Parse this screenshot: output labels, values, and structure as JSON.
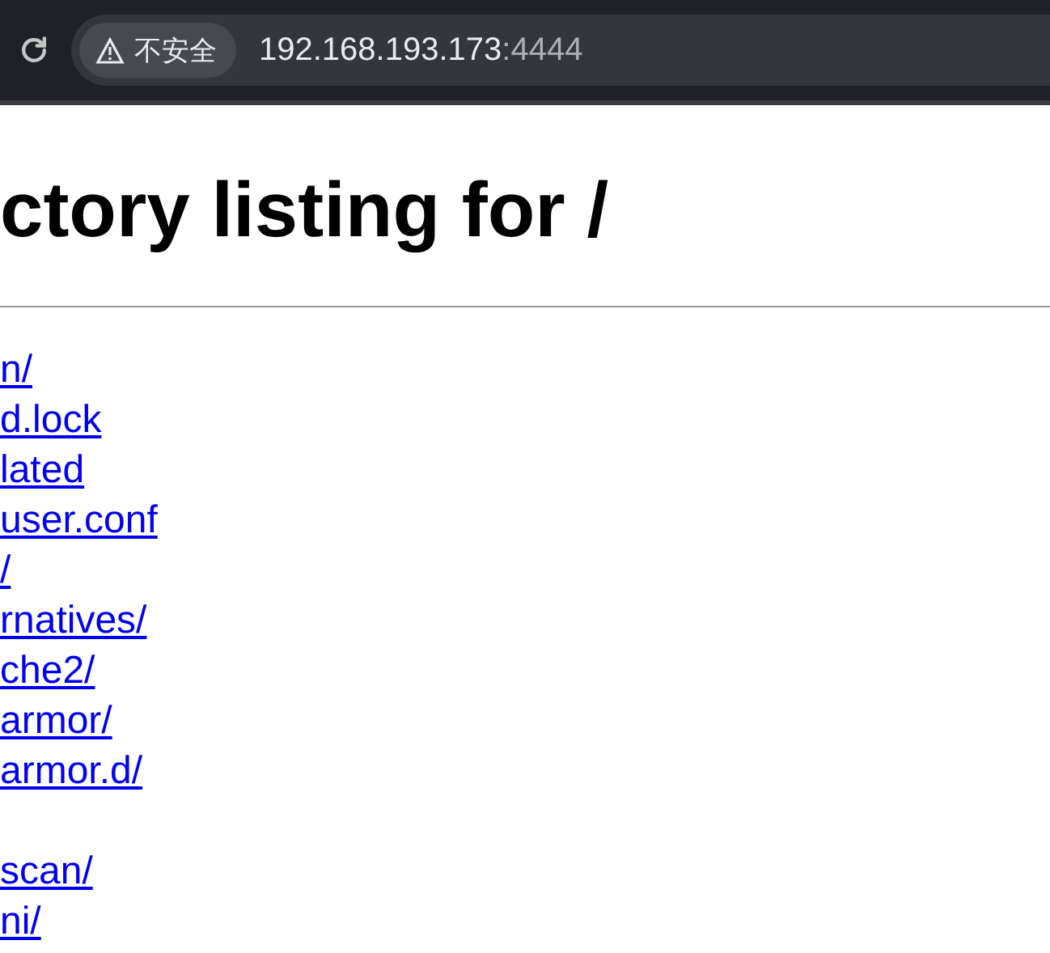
{
  "browser": {
    "security_label": "不安全",
    "url_host": "192.168.193.173",
    "url_port": ":4444"
  },
  "page": {
    "heading": "ctory listing for /",
    "listing_groups": [
      [
        "n/",
        "d.lock",
        "lated",
        "user.conf",
        "/",
        "rnatives/",
        "che2/",
        "armor/",
        "armor.d/"
      ],
      [
        "scan/",
        "ni/"
      ]
    ]
  }
}
